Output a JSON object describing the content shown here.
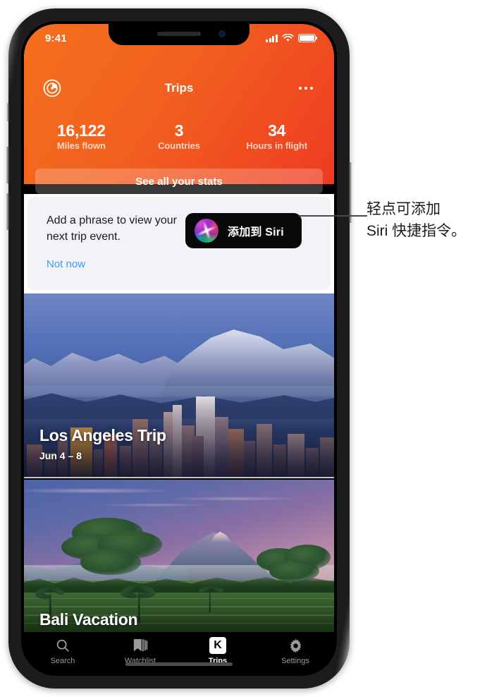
{
  "status_bar": {
    "time": "9:41",
    "icons": [
      "cellular-signal-icon",
      "wifi-icon",
      "battery-icon"
    ]
  },
  "header": {
    "title": "Trips",
    "left_icon": "radar-icon",
    "right_icon": "more-options-icon",
    "stats": [
      {
        "value": "16,122",
        "label": "Miles flown"
      },
      {
        "value": "3",
        "label": "Countries"
      },
      {
        "value": "34",
        "label": "Hours in flight"
      }
    ],
    "see_all_stats": "See all your stats",
    "gradient_from": "#f4701d",
    "gradient_to": "#ee3b22"
  },
  "siri_card": {
    "message": "Add a phrase to view your next trip event.",
    "dismiss_label": "Not now",
    "button_label": "添加到 Siri",
    "button_icon": "siri-orb-icon",
    "link_color": "#3d9bf7",
    "card_bg": "#f1f3f7",
    "button_bg": "#090909"
  },
  "trips": [
    {
      "title": "Los Angeles Trip",
      "dates": "Jun 4 – 8",
      "image": "los-angeles-skyline-photo"
    },
    {
      "title": "Bali Vacation",
      "dates": "",
      "image": "bali-rice-terrace-photo"
    }
  ],
  "tab_bar": {
    "items": [
      {
        "label": "Search",
        "icon": "search-icon",
        "active": false
      },
      {
        "label": "Watchlist",
        "icon": "bookmark-icon",
        "active": false
      },
      {
        "label": "Trips",
        "icon": "k-logo-icon",
        "active": true
      },
      {
        "label": "Settings",
        "icon": "gear-icon",
        "active": false
      }
    ]
  },
  "callout": {
    "line1": "轻点可添加",
    "line2": "Siri 快捷指令。"
  }
}
